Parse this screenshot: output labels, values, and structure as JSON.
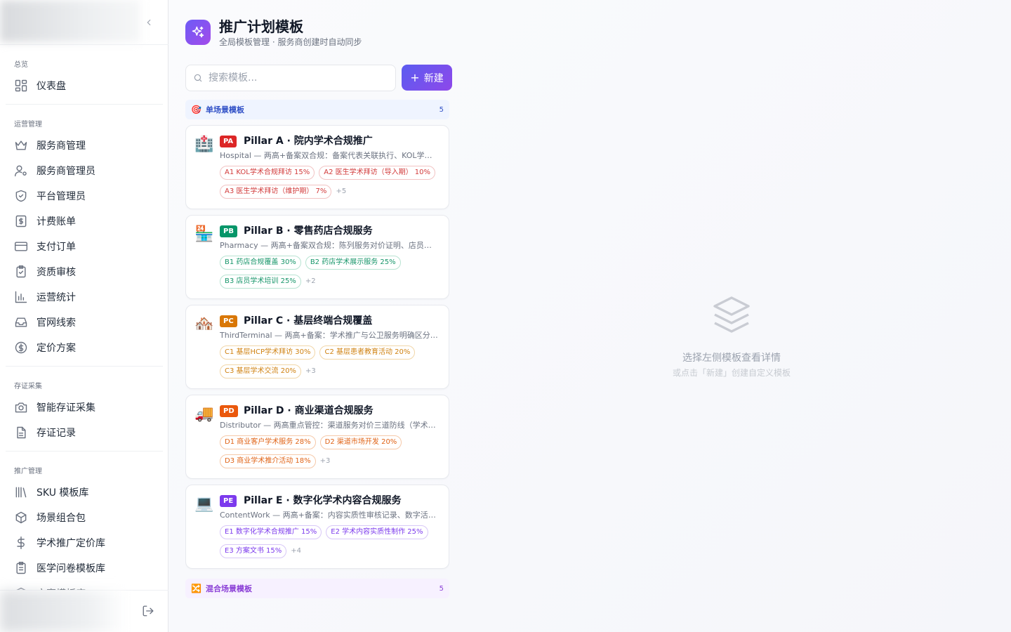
{
  "sidebar": {
    "groups": [
      {
        "title": "总览",
        "items": [
          {
            "label": "仪表盘",
            "icon": "dashboard-icon"
          }
        ]
      },
      {
        "title": "运营管理",
        "items": [
          {
            "label": "服务商管理",
            "icon": "crown-icon"
          },
          {
            "label": "服务商管理员",
            "icon": "user-gear-icon"
          },
          {
            "label": "平台管理员",
            "icon": "shield-icon"
          },
          {
            "label": "计费账单",
            "icon": "dollar-receipt-icon"
          },
          {
            "label": "支付订单",
            "icon": "credit-card-icon"
          },
          {
            "label": "资质审核",
            "icon": "clipboard-check-icon"
          },
          {
            "label": "运营统计",
            "icon": "bar-chart-icon"
          },
          {
            "label": "官网线索",
            "icon": "inbox-icon"
          },
          {
            "label": "定价方案",
            "icon": "dollar-circle-icon"
          }
        ]
      },
      {
        "title": "存证采集",
        "items": [
          {
            "label": "智能存证采集",
            "icon": "camera-icon"
          },
          {
            "label": "存证记录",
            "icon": "document-icon"
          }
        ]
      },
      {
        "title": "推广管理",
        "items": [
          {
            "label": "SKU 模板库",
            "icon": "library-icon"
          },
          {
            "label": "场景组合包",
            "icon": "package-icon"
          },
          {
            "label": "学术推广定价库",
            "icon": "dollar-icon"
          },
          {
            "label": "医学问卷模板库",
            "icon": "clipboard-list-icon"
          },
          {
            "label": "方案模板库",
            "icon": "layers-icon"
          }
        ]
      }
    ]
  },
  "header": {
    "title": "推广计划模板",
    "subtitle": "全局模板管理 · 服务商创建时自动同步"
  },
  "search": {
    "placeholder": "搜索模板...",
    "value": ""
  },
  "new_button": {
    "label": "新建"
  },
  "sections": {
    "single": {
      "icon": "🎯",
      "title": "单场景模板",
      "count": "5"
    },
    "mixed": {
      "icon": "🔀",
      "title": "混合场景模板",
      "count": "5"
    }
  },
  "templates": [
    {
      "emoji": "🏥",
      "badge": "PA",
      "badge_color": "#dc2626",
      "title": "Pillar A · 院内学术合规推广",
      "desc": "Hospital — 两高+备案双合规：备案代表关联执行、KOL学术…",
      "tags": [
        "A1 KOL学术合规拜访 15%",
        "A2 医生学术拜访（导入期） 10%",
        "A3 医生学术拜访（维护期） 7%"
      ],
      "more": "+5",
      "tag_style": "t-red"
    },
    {
      "emoji": "🏪",
      "badge": "PB",
      "badge_color": "#059669",
      "title": "Pillar B · 零售药店合规服务",
      "desc": "Pharmacy — 两高+备案双合规：陈列服务对价证明、店员学…",
      "tags": [
        "B1 药店合规覆盖 30%",
        "B2 药店学术展示服务 25%",
        "B3 店员学术培训 25%"
      ],
      "more": "+2",
      "tag_style": "t-green"
    },
    {
      "emoji": "🏘️",
      "badge": "PC",
      "badge_color": "#d97706",
      "title": "Pillar C · 基层终端合规覆盖",
      "desc": "ThirdTerminal — 两高+备案：学术推广与公卫服务明确区分、…",
      "tags": [
        "C1 基层HCP学术拜访 30%",
        "C2 基层患者教育活动 20%",
        "C3 基层学术交流 20%"
      ],
      "more": "+3",
      "tag_style": "t-amber"
    },
    {
      "emoji": "🚚",
      "badge": "PD",
      "badge_color": "#ea580c",
      "title": "Pillar D · 商业渠道合规服务",
      "desc": "Distributor — 两高重点管控：渠道服务对价三道防线（学术拜…",
      "tags": [
        "D1 商业客户学术服务 28%",
        "D2 渠道市场开发 20%",
        "D3 商业学术推介活动 18%"
      ],
      "more": "+3",
      "tag_style": "t-orange"
    },
    {
      "emoji": "💻",
      "badge": "PE",
      "badge_color": "#7c3aed",
      "title": "Pillar E · 数字化学术内容合规服务",
      "desc": "ContentWork — 两高+备案：内容实质性审核记录、数字活动…",
      "tags": [
        "E1 数字化学术合规推广 15%",
        "E2 学术内容实质性制作 25%",
        "E3 方案文书 15%"
      ],
      "more": "+4",
      "tag_style": "t-purple"
    }
  ],
  "empty_state": {
    "title": "选择左侧模板查看详情",
    "subtitle": "或点击「新建」创建自定义模板"
  },
  "colors": {
    "accent_start": "#5b5cf0",
    "accent_end": "#8e48ea"
  }
}
